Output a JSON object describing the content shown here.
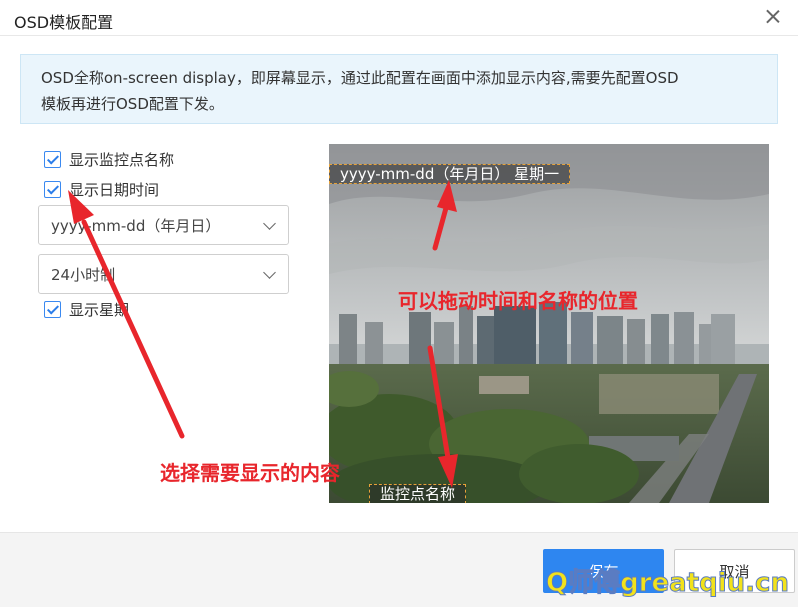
{
  "dialog": {
    "title": "OSD模板配置",
    "notice_line1": "OSD全称on-screen display，即屏幕显示，通过此配置在画面中添加显示内容,需要先配置OSD",
    "notice_line2": "模板再进行OSD配置下发。"
  },
  "options": {
    "show_point_name": {
      "label": "显示监控点名称",
      "checked": true
    },
    "show_datetime": {
      "label": "显示日期时间",
      "checked": true
    },
    "date_format": {
      "selected": "yyyy-mm-dd（年月日）"
    },
    "time_format": {
      "selected": "24小时制"
    },
    "show_weekday": {
      "label": "显示星期",
      "checked": true
    }
  },
  "preview": {
    "datetime_overlay": "yyyy-mm-dd（年月日） 星期一",
    "name_overlay": "监控点名称"
  },
  "annotations": {
    "drag_hint": "可以拖动时间和名称的位置",
    "select_hint": "选择需要显示的内容",
    "color": "#e8262c"
  },
  "buttons": {
    "save": "保存",
    "cancel": "取消"
  },
  "watermark": "Q师傅greatqiu.cn",
  "colors": {
    "accent": "#2e86f0",
    "notice_bg": "#eaf5fc",
    "osd_border": "#e7a23a"
  }
}
